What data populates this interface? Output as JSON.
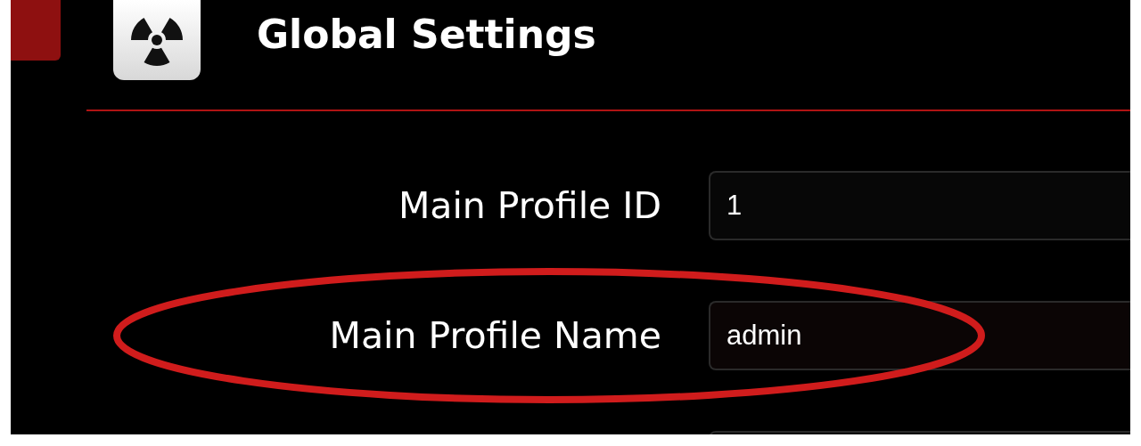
{
  "header": {
    "title": "Global Settings"
  },
  "fields": [
    {
      "kind": "text",
      "label": "Main Profile ID",
      "value": "1",
      "highlighted": false
    },
    {
      "kind": "text",
      "label": "Main Profile Name",
      "value": "admin",
      "highlighted": true
    },
    {
      "kind": "partial"
    }
  ]
}
